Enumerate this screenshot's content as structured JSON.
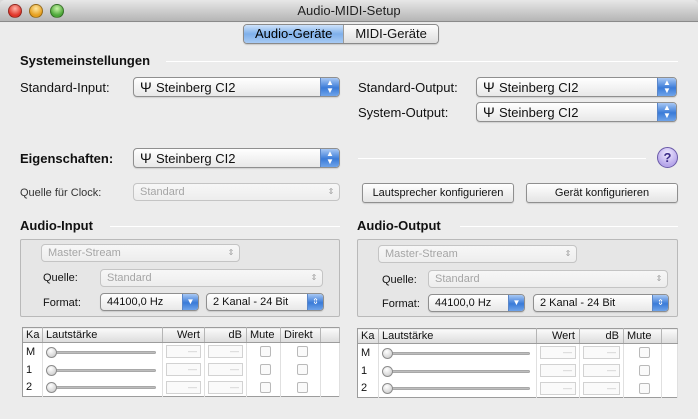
{
  "window": {
    "title": "Audio-MIDI-Setup"
  },
  "tabs": [
    {
      "label": "Audio-Geräte",
      "active": true
    },
    {
      "label": "MIDI-Geräte",
      "active": false
    }
  ],
  "system": {
    "heading": "Systemeinstellungen",
    "standard_input": {
      "label": "Standard-Input:",
      "value": "Steinberg CI2"
    },
    "standard_output": {
      "label": "Standard-Output:",
      "value": "Steinberg CI2"
    },
    "system_output": {
      "label": "System-Output:",
      "value": "Steinberg CI2"
    }
  },
  "properties": {
    "label": "Eigenschaften:",
    "value": "Steinberg CI2",
    "help": "?",
    "clock_label": "Quelle für Clock:",
    "clock_value": "Standard",
    "speaker_button": "Lautsprecher konfigurieren",
    "device_button": "Gerät konfigurieren"
  },
  "audio_input": {
    "heading": "Audio-Input",
    "stream": "Master-Stream",
    "source_label": "Quelle:",
    "source_value": "Standard",
    "format_label": "Format:",
    "rate": "44100,0 Hz",
    "channels": "2 Kanal - 24 Bit",
    "columns": [
      "Ka",
      "Lautstärke",
      "Wert",
      "dB",
      "Mute",
      "Direkt"
    ],
    "rows": [
      {
        "channel": "M",
        "wert": "—",
        "db": "—"
      },
      {
        "channel": "1",
        "wert": "—",
        "db": "—"
      },
      {
        "channel": "2",
        "wert": "—",
        "db": "—"
      }
    ]
  },
  "audio_output": {
    "heading": "Audio-Output",
    "stream": "Master-Stream",
    "source_label": "Quelle:",
    "source_value": "Standard",
    "format_label": "Format:",
    "rate": "44100,0 Hz",
    "channels": "2 Kanal - 24 Bit",
    "columns": [
      "Ka",
      "Lautstärke",
      "Wert",
      "dB",
      "Mute"
    ],
    "rows": [
      {
        "channel": "M",
        "wert": "—",
        "db": "—"
      },
      {
        "channel": "1",
        "wert": "—",
        "db": "—"
      },
      {
        "channel": "2",
        "wert": "—",
        "db": "—"
      }
    ]
  },
  "colors": {
    "accent": "#3a7bd8",
    "window_bg": "#ececec",
    "help_purple": "#b7a7ea"
  }
}
